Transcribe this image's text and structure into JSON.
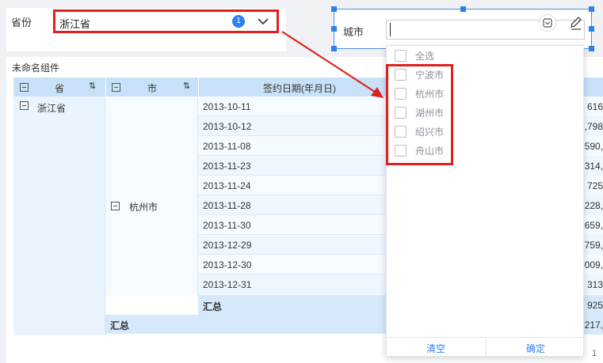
{
  "province_filter": {
    "label": "省份",
    "value": "浙江省",
    "badge": "1"
  },
  "city_filter": {
    "label": "城市",
    "value": ""
  },
  "widget": {
    "title": "未命名组件"
  },
  "table": {
    "headers": {
      "province": "省",
      "city": "市",
      "date": "签约日期(年月日)"
    },
    "province_value": "浙江省",
    "city_value": "杭州市",
    "dates": [
      "2013-10-11",
      "2013-10-12",
      "2013-11-08",
      "2013-11-23",
      "2013-11-24",
      "2013-11-28",
      "2013-11-30",
      "2013-12-29",
      "2013-12-30",
      "2013-12-31"
    ],
    "values": [
      "616",
      ",798",
      "590,",
      "314,",
      "725",
      "228,",
      "659,",
      "759,",
      "009,",
      "313",
      "925",
      "217,"
    ],
    "subtotal_label": "汇总",
    "total_label": "汇总"
  },
  "dropdown": {
    "options": [
      "全选",
      "宁波市",
      "杭州市",
      "湖州市",
      "绍兴市",
      "舟山市"
    ],
    "clear_label": "清空",
    "confirm_label": "确定"
  },
  "pagination": {
    "page": "1"
  },
  "colors": {
    "highlight_red": "#e02020",
    "accent_blue": "#2f80ed",
    "header_blue": "#c8e1f8"
  }
}
